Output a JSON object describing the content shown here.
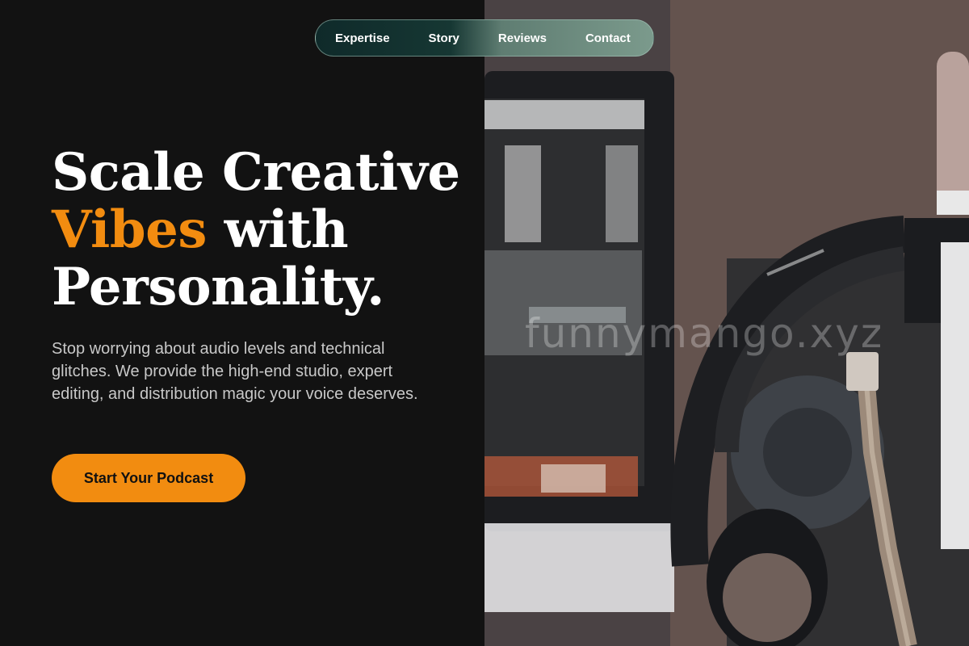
{
  "nav": {
    "items": [
      {
        "label": "Expertise"
      },
      {
        "label": "Story"
      },
      {
        "label": "Reviews"
      },
      {
        "label": "Contact"
      }
    ]
  },
  "hero": {
    "title_line1": "Scale Creative",
    "title_accent": "Vibes",
    "title_mid": " with",
    "title_line3": "Personality.",
    "description": "Stop worrying about audio levels and technical glitches. We provide the high-end studio, expert editing, and distribution magic your voice deserves.",
    "cta_label": "Start Your Podcast"
  },
  "watermark": "funnymango.xyz",
  "image": {
    "icon": "studio-microphone-headphones-photo"
  },
  "colors": {
    "background": "#121212",
    "accent": "#f28c10",
    "text": "#ffffff",
    "body_text": "#c8c8c8"
  }
}
